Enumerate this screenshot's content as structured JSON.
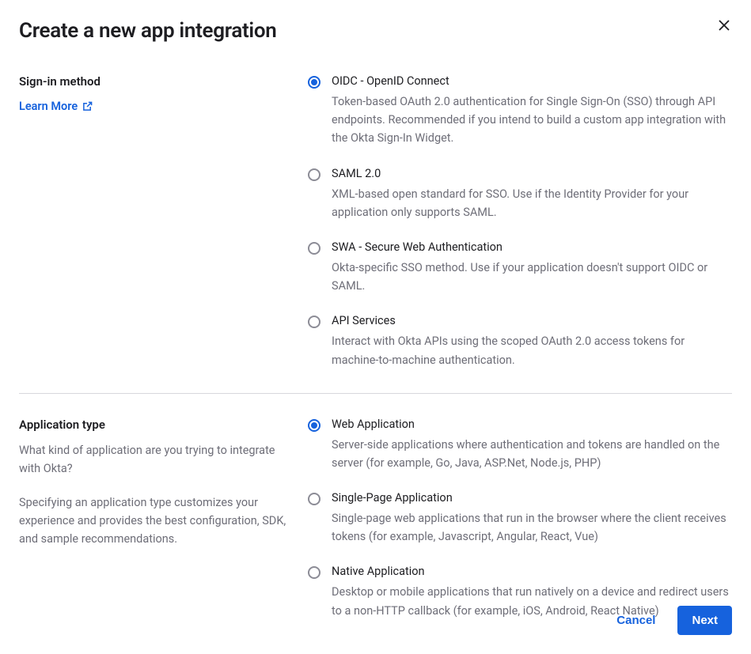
{
  "modal": {
    "title": "Create a new app integration"
  },
  "sections": {
    "sign_in": {
      "heading": "Sign-in method",
      "learn_more": "Learn More",
      "options": [
        {
          "label": "OIDC - OpenID Connect",
          "description": "Token-based OAuth 2.0 authentication for Single Sign-On (SSO) through API endpoints. Recommended if you intend to build a custom app integration with the Okta Sign-In Widget.",
          "selected": true
        },
        {
          "label": "SAML 2.0",
          "description": "XML-based open standard for SSO. Use if the Identity Provider for your application only supports SAML.",
          "selected": false
        },
        {
          "label": "SWA - Secure Web Authentication",
          "description": "Okta-specific SSO method. Use if your application doesn't support OIDC or SAML.",
          "selected": false
        },
        {
          "label": "API Services",
          "description": "Interact with Okta APIs using the scoped OAuth 2.0 access tokens for machine-to-machine authentication.",
          "selected": false
        }
      ]
    },
    "app_type": {
      "heading": "Application type",
      "sub1": "What kind of application are you trying to integrate with Okta?",
      "sub2": "Specifying an application type customizes your experience and provides the best configuration, SDK, and sample recommendations.",
      "options": [
        {
          "label": "Web Application",
          "description": "Server-side applications where authentication and tokens are handled on the server (for example, Go, Java, ASP.Net, Node.js, PHP)",
          "selected": true
        },
        {
          "label": "Single-Page Application",
          "description": "Single-page web applications that run in the browser where the client receives tokens (for example, Javascript, Angular, React, Vue)",
          "selected": false
        },
        {
          "label": "Native Application",
          "description": "Desktop or mobile applications that run natively on a device and redirect users to a non-HTTP callback (for example, iOS, Android, React Native)",
          "selected": false
        }
      ]
    }
  },
  "footer": {
    "cancel": "Cancel",
    "next": "Next"
  }
}
